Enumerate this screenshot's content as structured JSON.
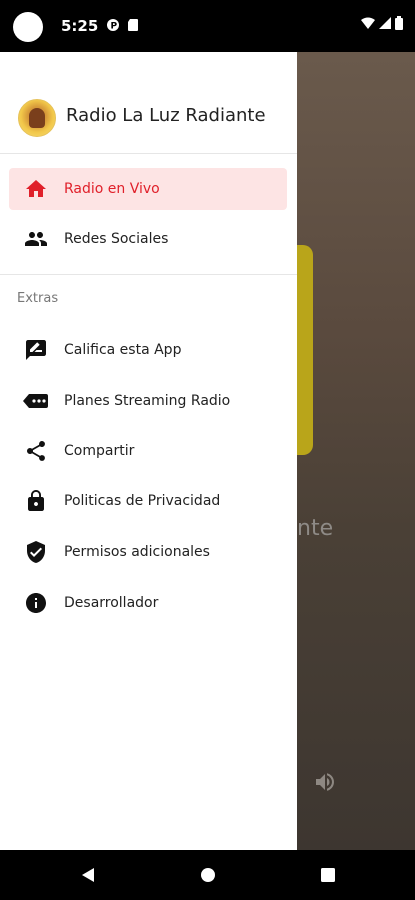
{
  "status_bar": {
    "time": "5:25",
    "icons_left": [
      "camera-cutout-icon",
      "p-badge-icon",
      "sd-card-icon"
    ],
    "icons_right": [
      "wifi-icon",
      "signal-icon",
      "battery-icon"
    ]
  },
  "drawer": {
    "app_name": "Radio La Luz Radiante",
    "primary_items": [
      {
        "label": "Radio en Vivo",
        "icon": "home-icon",
        "active": true
      },
      {
        "label": "Redes Sociales",
        "icon": "people-icon",
        "active": false
      }
    ],
    "section_title": "Extras",
    "extra_items": [
      {
        "label": "Califica esta App",
        "icon": "rate-review-icon"
      },
      {
        "label": "Planes Streaming Radio",
        "icon": "label-tag-icon"
      },
      {
        "label": "Compartir",
        "icon": "share-icon"
      },
      {
        "label": "Politicas de Privacidad",
        "icon": "lock-icon"
      },
      {
        "label": "Permisos adicionales",
        "icon": "verified-shield-icon"
      },
      {
        "label": "Desarrollador",
        "icon": "info-icon"
      }
    ]
  },
  "background": {
    "title_fragment": "nte"
  },
  "colors": {
    "accent": "#e0202a",
    "active_bg": "#fde4e4",
    "icon": "#111111"
  }
}
